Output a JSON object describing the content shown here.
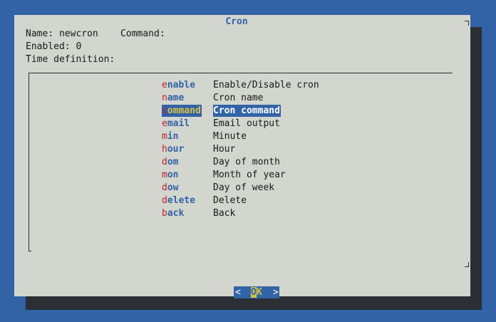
{
  "dialog": {
    "title": "Cron",
    "name_line": "Name: newcron    Command:",
    "enabled_line": "Enabled: 0",
    "time_line": "Time definition:"
  },
  "menu": {
    "items": [
      {
        "hot": "e",
        "rest": "nable",
        "desc": "Enable/Disable cron",
        "selected": false
      },
      {
        "hot": "n",
        "rest": "ame",
        "desc": "Cron name",
        "selected": false
      },
      {
        "hot": "c",
        "rest": "ommand",
        "desc": "Cron command",
        "selected": true
      },
      {
        "hot": "e",
        "rest": "mail",
        "desc": "Email output",
        "selected": false
      },
      {
        "hot": "m",
        "rest": "in",
        "desc": "Minute",
        "selected": false
      },
      {
        "hot": "h",
        "rest": "our",
        "desc": "Hour",
        "selected": false
      },
      {
        "hot": "d",
        "rest": "om",
        "desc": "Day of month",
        "selected": false
      },
      {
        "hot": "m",
        "rest": "on",
        "desc": "Month of year",
        "selected": false
      },
      {
        "hot": "d",
        "rest": "ow",
        "desc": "Day of week",
        "selected": false
      },
      {
        "hot": "d",
        "rest": "elete",
        "desc": "Delete",
        "selected": false
      },
      {
        "hot": "b",
        "rest": "ack",
        "desc": "Back",
        "selected": false
      }
    ]
  },
  "buttons": {
    "ok": {
      "left": "<",
      "hot": "O",
      "rest": "K",
      "right": ">"
    }
  },
  "colors": {
    "background": "#3163a6",
    "dialog": "#d3d5cf",
    "accent": "#3163a6",
    "hotkey": "#c0202a",
    "selected_tag": "#d6c24a"
  }
}
